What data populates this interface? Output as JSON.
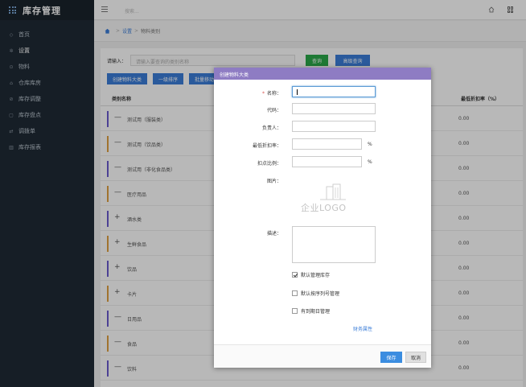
{
  "app": {
    "title": "库存管理"
  },
  "sidebar": {
    "items": [
      {
        "label": "首页",
        "icon": "home-icon"
      },
      {
        "label": "设置",
        "icon": "gear-icon"
      },
      {
        "label": "物料",
        "icon": "cube-icon"
      },
      {
        "label": "仓库库房",
        "icon": "warehouse-icon"
      },
      {
        "label": "库存调整",
        "icon": "adjust-icon"
      },
      {
        "label": "库存盘点",
        "icon": "clipboard-icon"
      },
      {
        "label": "调拨单",
        "icon": "transfer-icon"
      },
      {
        "label": "库存报表",
        "icon": "chart-icon"
      }
    ]
  },
  "topbar": {
    "search_placeholder": "搜索..."
  },
  "breadcrumb": {
    "items": [
      "设置",
      "物料类别"
    ]
  },
  "search": {
    "label": "请输入：",
    "placeholder": "请输入要查询的类别名称",
    "query_button": "查询",
    "advanced_button": "高级查询"
  },
  "actions": {
    "create": "创建物料大类",
    "sort": "一级排序",
    "batch": "批量移动"
  },
  "table": {
    "col_name": "类别名称",
    "col_discount": "最低折扣率（%）",
    "rows": [
      {
        "sign": "—",
        "name": "测试用（服装类）",
        "discount": "0.00",
        "bar": "#6a5acd"
      },
      {
        "sign": "—",
        "name": "测试用（饮品类）",
        "discount": "0.00",
        "bar": "#e0a040"
      },
      {
        "sign": "—",
        "name": "测试用（非化食品类）",
        "discount": "0.00",
        "bar": "#6a5acd"
      },
      {
        "sign": "—",
        "name": "医疗用品",
        "discount": "0.00",
        "bar": "#e0a040"
      },
      {
        "sign": "+",
        "name": "酒水类",
        "discount": "0.00",
        "bar": "#6a5acd"
      },
      {
        "sign": "+",
        "name": "生鲜食品",
        "discount": "0.00",
        "bar": "#e0a040"
      },
      {
        "sign": "+",
        "name": "饮品",
        "discount": "0.00",
        "bar": "#6a5acd"
      },
      {
        "sign": "+",
        "name": "卡片",
        "discount": "0.00",
        "bar": "#e0a040"
      },
      {
        "sign": "—",
        "name": "日用品",
        "discount": "0.00",
        "bar": "#6a5acd"
      },
      {
        "sign": "—",
        "name": "食品",
        "discount": "0.00",
        "bar": "#e0a040"
      },
      {
        "sign": "—",
        "name": "饮料",
        "discount": "0.00",
        "bar": "#6a5acd"
      }
    ]
  },
  "modal": {
    "title": "创建物料大类",
    "fields": {
      "name": "名称：",
      "code": "代码：",
      "owner": "负责人：",
      "min_discount": "最低折扣率：",
      "deduct_ratio": "扣点比例：",
      "image": "图片：",
      "description": "描述："
    },
    "percent": "%",
    "logo_text": "企业LOGO",
    "checkboxes": [
      {
        "label": "默认管理库存",
        "checked": true
      },
      {
        "label": "默认按序列号管理",
        "checked": false
      },
      {
        "label": "有到期日管理",
        "checked": false
      }
    ],
    "finance_link": "财务属性",
    "save": "保存",
    "cancel": "取消"
  },
  "colors": {
    "accent": "#3b7dd8",
    "modal_header": "#8e7cc3",
    "sidebar": "#1f2a35",
    "green": "#2aa84a"
  }
}
